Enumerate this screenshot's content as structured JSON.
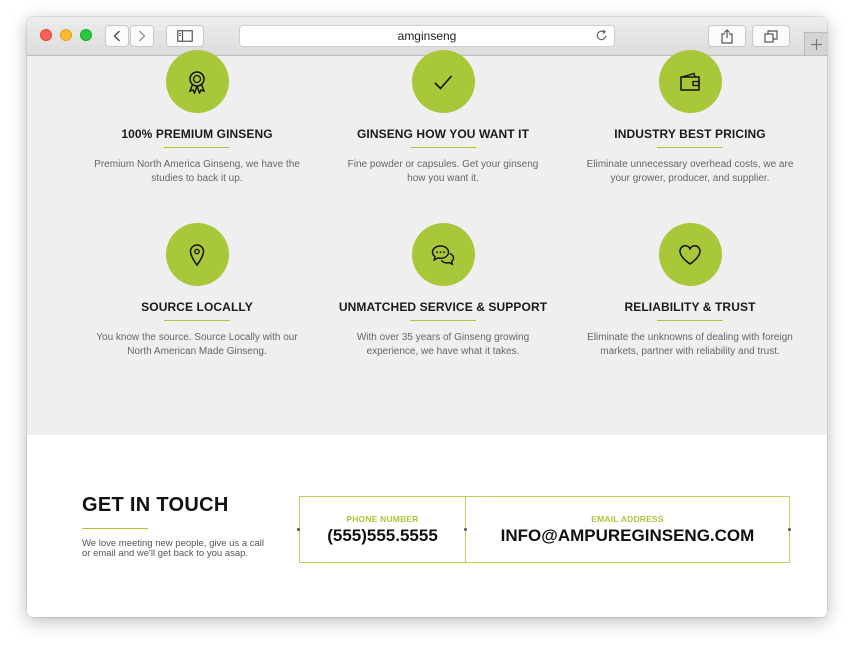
{
  "browser": {
    "url_text": "amginseng"
  },
  "features": [
    {
      "icon": "award-ribbon-icon",
      "title": "100% PREMIUM GINSENG",
      "desc": "Premium North America Ginseng, we have the studies to back it up."
    },
    {
      "icon": "checkmark-icon",
      "title": "GINSENG HOW YOU WANT IT",
      "desc": "Fine powder or capsules. Get your ginseng how you want it."
    },
    {
      "icon": "wallet-icon",
      "title": "INDUSTRY BEST PRICING",
      "desc": "Eliminate unnecessary overhead costs, we are your grower, producer, and supplier."
    },
    {
      "icon": "map-pin-icon",
      "title": "SOURCE LOCALLY",
      "desc": "You know the source. Source Locally with our North American Made Ginseng."
    },
    {
      "icon": "chat-bubbles-icon",
      "title": "UNMATCHED SERVICE & SUPPORT",
      "desc": "With over 35 years of Ginseng growing experience, we have what it takes."
    },
    {
      "icon": "heart-icon",
      "title": "RELIABILITY & TRUST",
      "desc": "Eliminate the unknowns of dealing with foreign markets, partner with reliability and trust."
    }
  ],
  "contact": {
    "heading": "GET IN TOUCH",
    "desc": "We love meeting new people, give us a call or email and we'll get back to you asap.",
    "phone_label": "PHONE NUMBER",
    "phone_value": "(555)555.5555",
    "email_label": "EMAIL ADDRESS",
    "email_value": "INFO@AMPUREGINSENG.COM"
  },
  "colors": {
    "accent": "#a8c83a",
    "section_bg": "#efefef"
  }
}
